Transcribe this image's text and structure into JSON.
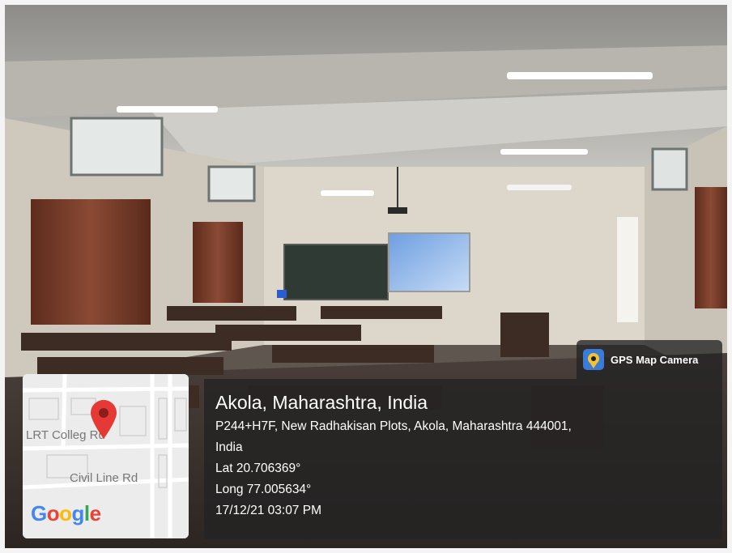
{
  "overlay": {
    "app_badge": {
      "label": "GPS Map Camera",
      "icon": "gps-map-camera-icon"
    },
    "map": {
      "road_labels": [
        "LRT Colleg  Rd",
        "Civil Line Rd"
      ],
      "logo": "Google",
      "marker_icon": "map-pin-icon",
      "marker_color": "#e53935"
    },
    "location": {
      "place": "Akola, Maharashtra, India",
      "address_line1": "P244+H7F, New Radhakisan Plots, Akola, Maharashtra 444001,",
      "address_line2": "India",
      "lat": "Lat 20.706369°",
      "long": "Long 77.005634°",
      "datetime": "17/12/21 03:07 PM"
    }
  }
}
